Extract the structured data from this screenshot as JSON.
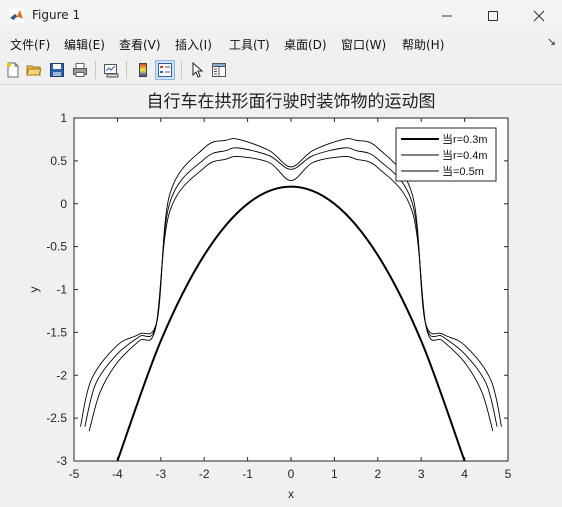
{
  "window": {
    "title": "Figure 1",
    "controls": [
      "minimize",
      "maximize",
      "close"
    ]
  },
  "menu": [
    "文件(F)",
    "编辑(E)",
    "查看(V)",
    "插入(I)",
    "工具(T)",
    "桌面(D)",
    "窗口(W)",
    "帮助(H)"
  ],
  "toolbar": {
    "icons": [
      "new-figure-icon",
      "open-file-icon",
      "save-icon",
      "print-icon",
      "link-plot-icon",
      "colorbar-icon",
      "legend-icon",
      "pointer-icon",
      "property-inspector-icon"
    ],
    "active": "legend-icon"
  },
  "colors": {
    "plot_background": "#ffffff",
    "figure_background": "#f0f0f0",
    "line": "#000000"
  },
  "chart_data": {
    "type": "line",
    "title": "自行车在拱形面行驶时装饰物的运动图",
    "xlabel": "x",
    "ylabel": "y",
    "xlim": [
      -5,
      5
    ],
    "ylim": [
      -3,
      1
    ],
    "xticks": [
      "-5",
      "-4",
      "-3",
      "-2",
      "-1",
      "0",
      "1",
      "2",
      "3",
      "4",
      "5"
    ],
    "yticks": [
      "1",
      "0.5",
      "0",
      "-0.5",
      "-1",
      "-1.5",
      "-2",
      "-2.5",
      "-3"
    ],
    "grid": false,
    "legend_position": "top-right",
    "surface": {
      "name": "当r=0.3m",
      "equation": "y = 0.2 - x^2/5",
      "x": [
        -4,
        -3,
        -2,
        -1,
        0,
        1,
        2,
        3,
        4
      ],
      "y": [
        -3,
        -1.6,
        -0.6,
        0,
        0.2,
        0,
        -0.6,
        -1.6,
        -3
      ],
      "line_width": 2
    },
    "series": [
      {
        "name": "当r=0.4m",
        "x": [
          -4.75,
          -4.5,
          -4,
          -3.5,
          -3.1,
          -2.8,
          -2,
          -1.5,
          -1.2,
          -0.5,
          0,
          0.5,
          1.2,
          1.5,
          2,
          2.8,
          3.1,
          3.5,
          4,
          4.5,
          4.75
        ],
        "y": [
          -2.6,
          -2.1,
          -1.75,
          -1.55,
          -1.4,
          0.0,
          0.52,
          0.62,
          0.65,
          0.56,
          0.4,
          0.56,
          0.65,
          0.62,
          0.52,
          0.0,
          -1.4,
          -1.55,
          -1.75,
          -2.1,
          -2.6
        ]
      },
      {
        "name": "当=0.5m",
        "x": [
          -4.85,
          -4.6,
          -4,
          -3.5,
          -3.08,
          -2.8,
          -2,
          -1.5,
          -1.2,
          -0.5,
          0,
          0.5,
          1.2,
          1.5,
          2,
          2.8,
          3.08,
          3.5,
          4,
          4.6,
          4.85
        ],
        "y": [
          -2.6,
          -2.05,
          -1.65,
          -1.52,
          -1.35,
          0.1,
          0.65,
          0.74,
          0.75,
          0.62,
          0.43,
          0.62,
          0.75,
          0.74,
          0.65,
          0.1,
          -1.35,
          -1.52,
          -1.65,
          -2.05,
          -2.6
        ]
      },
      {
        "x": [
          -4.65,
          -4.4,
          -4,
          -3.5,
          -3.12,
          -2.8,
          -2,
          -1.5,
          -1.2,
          -0.5,
          0,
          0.5,
          1.2,
          1.5,
          2,
          2.8,
          3.12,
          3.5,
          4,
          4.4,
          4.65
        ],
        "y": [
          -2.65,
          -2.2,
          -1.85,
          -1.6,
          -1.45,
          -0.1,
          0.42,
          0.52,
          0.55,
          0.48,
          0.27,
          0.48,
          0.55,
          0.52,
          0.42,
          -0.1,
          -1.45,
          -1.6,
          -1.85,
          -2.2,
          -2.65
        ]
      }
    ]
  }
}
